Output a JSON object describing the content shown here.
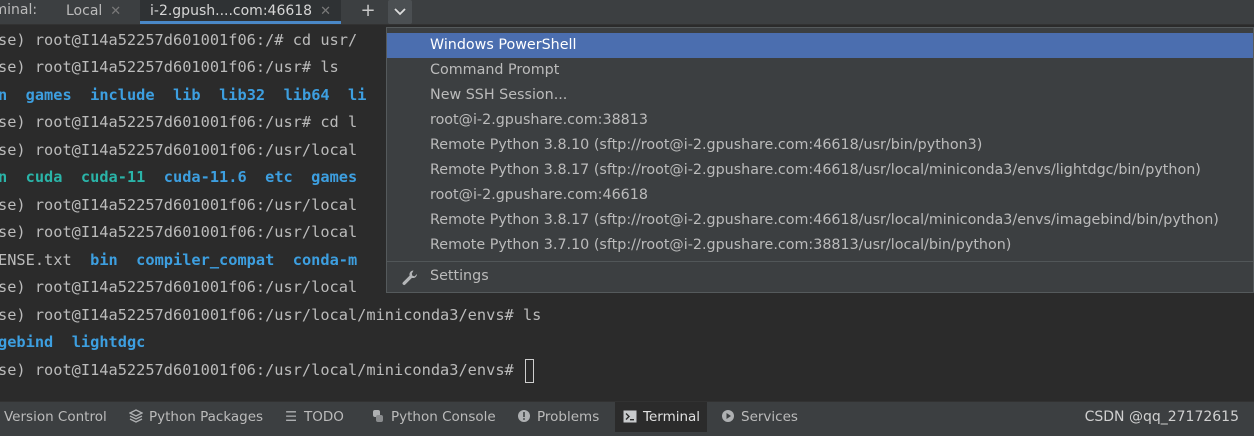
{
  "tabbar": {
    "label": "rminal:",
    "tabs": [
      {
        "label": "Local"
      },
      {
        "label": "i-2.gpush....com:46618"
      }
    ],
    "add_icon": "plus-icon",
    "dropdown_icon": "chevron-down-icon"
  },
  "terminal": {
    "lines": [
      {
        "prompt": "se) root@I14a52257d601001f06:/# ",
        "cmd": "cd usr/"
      },
      {
        "prompt": "se) root@I14a52257d601001f06:/usr# ",
        "cmd": "ls"
      },
      {
        "items": [
          "n",
          "games",
          "include",
          "lib",
          "lib32",
          "lib64",
          "li"
        ]
      },
      {
        "prompt": "se) root@I14a52257d601001f06:/usr# ",
        "cmd": "cd l"
      },
      {
        "prompt": "se) root@I14a52257d601001f06:/usr/local"
      },
      {
        "items": [
          "n",
          "cuda",
          "cuda-11",
          "cuda-11.6",
          "etc",
          "games"
        ]
      },
      {
        "prompt": "se) root@I14a52257d601001f06:/usr/local"
      },
      {
        "prompt": "se) root@I14a52257d601001f06:/usr/local"
      },
      {
        "items": [
          "ENSE.txt",
          "bin",
          "compiler_compat",
          "conda-m"
        ]
      },
      {
        "prompt": "se) root@I14a52257d601001f06:/usr/local"
      },
      {
        "prompt": "se) root@I14a52257d601001f06:/usr/local/miniconda3/envs# ",
        "cmd": "ls"
      },
      {
        "items": [
          "gebind",
          "lightdgc"
        ]
      },
      {
        "prompt": "se) root@I14a52257d601001f06:/usr/local/miniconda3/envs# "
      }
    ]
  },
  "menu": {
    "items": [
      "Windows PowerShell",
      "Command Prompt",
      "New SSH Session...",
      "root@i-2.gpushare.com:38813",
      "Remote Python 3.8.10 (sftp://root@i-2.gpushare.com:46618/usr/bin/python3)",
      "Remote Python 3.8.17 (sftp://root@i-2.gpushare.com:46618/usr/local/miniconda3/envs/lightdgc/bin/python)",
      "root@i-2.gpushare.com:46618",
      "Remote Python 3.8.17 (sftp://root@i-2.gpushare.com:46618/usr/local/miniconda3/envs/imagebind/bin/python)",
      "Remote Python 3.7.10 (sftp://root@i-2.gpushare.com:38813/usr/local/bin/python)"
    ],
    "selected_index": 0,
    "settings_label": "Settings",
    "settings_icon": "wrench-icon"
  },
  "bottombar": {
    "tools": [
      {
        "label": "Version Control",
        "icon": "version-control-icon"
      },
      {
        "label": "Python Packages",
        "icon": "layers-icon"
      },
      {
        "label": "TODO",
        "icon": "list-icon"
      },
      {
        "label": "Python Console",
        "icon": "python-icon"
      },
      {
        "label": "Problems",
        "icon": "problems-icon"
      },
      {
        "label": "Terminal",
        "icon": "terminal-icon"
      },
      {
        "label": "Services",
        "icon": "services-icon"
      }
    ],
    "active_index": 5,
    "credit": "CSDN @qq_27172615"
  },
  "colors": {
    "background": "#2b2b2b",
    "panel": "#3c3f41",
    "selection": "#4b6eaf",
    "directory": "#3d9fe0",
    "teal": "#2ab4a8"
  }
}
